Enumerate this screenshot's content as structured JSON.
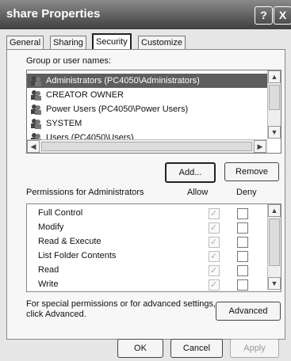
{
  "window": {
    "title": "share Properties",
    "help_btn": "?",
    "close_btn": "X"
  },
  "tabs": [
    {
      "label": "General"
    },
    {
      "label": "Sharing"
    },
    {
      "label": "Security"
    },
    {
      "label": "Customize"
    }
  ],
  "security": {
    "group_label": "Group or user names:",
    "users": [
      {
        "name": "Administrators (PC4050\\Administrators)"
      },
      {
        "name": "CREATOR OWNER"
      },
      {
        "name": "Power Users (PC4050\\Power Users)"
      },
      {
        "name": "SYSTEM"
      },
      {
        "name": "Users (PC4050\\Users)"
      }
    ],
    "add_button": "Add...",
    "remove_button": "Remove",
    "permissions_label": "Permissions for Administrators",
    "allow_header": "Allow",
    "deny_header": "Deny",
    "permissions": [
      {
        "name": "Full Control",
        "allow": true,
        "deny": false
      },
      {
        "name": "Modify",
        "allow": true,
        "deny": false
      },
      {
        "name": "Read & Execute",
        "allow": true,
        "deny": false
      },
      {
        "name": "List Folder Contents",
        "allow": true,
        "deny": false
      },
      {
        "name": "Read",
        "allow": true,
        "deny": false
      },
      {
        "name": "Write",
        "allow": true,
        "deny": false
      }
    ],
    "advanced_text": "For special permissions or for advanced settings, click Advanced.",
    "advanced_button": "Advanced"
  },
  "footer": {
    "ok": "OK",
    "cancel": "Cancel",
    "apply": "Apply"
  }
}
